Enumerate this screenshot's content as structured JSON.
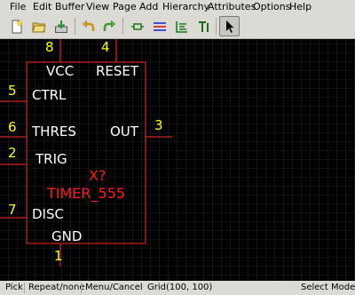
{
  "menu": [
    "File",
    "Edit",
    "Buffer",
    "View",
    "Page",
    "Add",
    "Hierarchy",
    "Attributes",
    "Options",
    "Help"
  ],
  "toolbar": {
    "buttons": [
      {
        "name": "new-file-icon"
      },
      {
        "name": "open-file-icon"
      },
      {
        "name": "save-file-icon"
      },
      {
        "name": "undo-icon"
      },
      {
        "name": "redo-icon"
      },
      {
        "name": "add-component-icon"
      },
      {
        "name": "add-net-icon"
      },
      {
        "name": "add-attribute-icon"
      },
      {
        "name": "add-text-icon"
      },
      {
        "name": "select-arrow-icon",
        "active": true
      }
    ]
  },
  "schematic": {
    "pins": {
      "vcc": {
        "number": "8",
        "label": "VCC"
      },
      "reset": {
        "number": "4",
        "label": "RESET"
      },
      "ctrl": {
        "number": "5",
        "label": "CTRL"
      },
      "thres": {
        "number": "6",
        "label": "THRES"
      },
      "out": {
        "number": "3",
        "label": "OUT"
      },
      "trig": {
        "number": "2",
        "label": "TRIG"
      },
      "disc": {
        "number": "7",
        "label": "DISC"
      },
      "gnd": {
        "number": "1",
        "label": "GND"
      }
    },
    "refdes": "X?",
    "device": "TIMER_555"
  },
  "colors": {
    "canvas_bg": "#000000",
    "grid": "#3a3a3a",
    "body": "#d42222",
    "pin_number": "#ffff00",
    "pin_label": "#ffffff",
    "attribute": "#ff1a1a"
  },
  "status": {
    "mode": "Pick",
    "repeat": "Repeat/none",
    "menu": "Menu/Cancel",
    "grid": "Grid(100, 100)",
    "select_mode": "Select Mode"
  }
}
